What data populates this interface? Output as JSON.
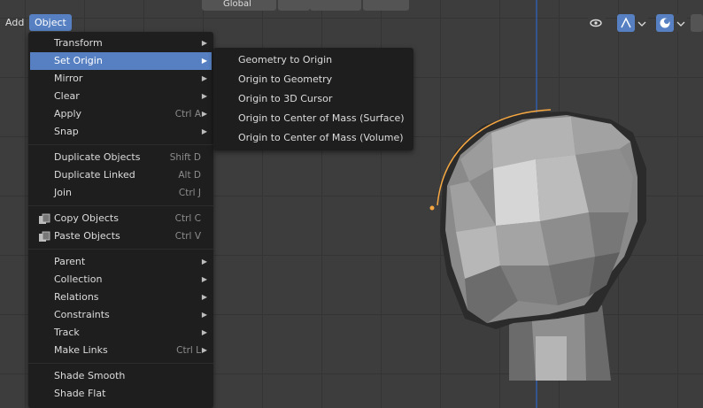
{
  "menubar": {
    "add": "Add",
    "object": "Object"
  },
  "header": {
    "orientation": "Global"
  },
  "object_menu": {
    "groups": [
      [
        {
          "label": "Transform",
          "submenu": true
        },
        {
          "label": "Set Origin",
          "submenu": true,
          "highlighted": true
        },
        {
          "label": "Mirror",
          "submenu": true
        },
        {
          "label": "Clear",
          "submenu": true
        },
        {
          "label": "Apply",
          "shortcut": "Ctrl A",
          "submenu": true
        },
        {
          "label": "Snap",
          "submenu": true
        }
      ],
      [
        {
          "label": "Duplicate Objects",
          "shortcut": "Shift D"
        },
        {
          "label": "Duplicate Linked",
          "shortcut": "Alt D"
        },
        {
          "label": "Join",
          "shortcut": "Ctrl J"
        }
      ],
      [
        {
          "label": "Copy Objects",
          "shortcut": "Ctrl C",
          "icon": "copy-icon"
        },
        {
          "label": "Paste Objects",
          "shortcut": "Ctrl V",
          "icon": "paste-icon"
        }
      ],
      [
        {
          "label": "Parent",
          "submenu": true
        },
        {
          "label": "Collection",
          "submenu": true
        },
        {
          "label": "Relations",
          "submenu": true
        },
        {
          "label": "Constraints",
          "submenu": true
        },
        {
          "label": "Track",
          "submenu": true
        },
        {
          "label": "Make Links",
          "shortcut": "Ctrl L",
          "submenu": true
        }
      ],
      [
        {
          "label": "Shade Smooth"
        },
        {
          "label": "Shade Flat"
        }
      ]
    ]
  },
  "origin_menu": {
    "items": [
      "Geometry to Origin",
      "Origin to Geometry",
      "Origin to 3D Cursor",
      "Origin to Center of Mass (Surface)",
      "Origin to Center of Mass (Volume)"
    ]
  },
  "colors": {
    "accent": "#5680c2",
    "menu_bg": "#1e1e1e",
    "viewport_bg": "#3d3d3d",
    "selection_outline": "#f5a742",
    "axis_blue": "#2e64c8"
  }
}
